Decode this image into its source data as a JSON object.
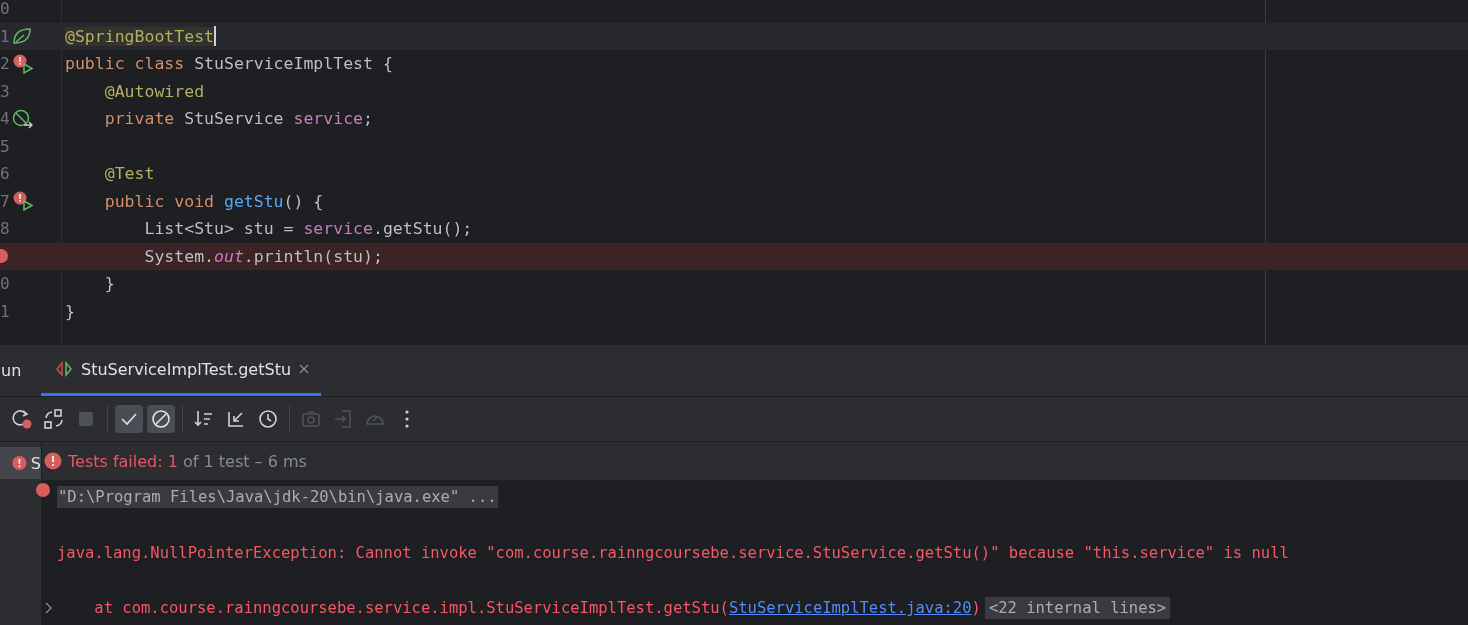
{
  "editor": {
    "lines": [
      {
        "number": "0",
        "current": false,
        "breakpoint": false
      },
      {
        "number": "1",
        "marker": {
          "kind": "leaf"
        },
        "current": true,
        "breakpoint": false,
        "tokens": [
          {
            "text": "@SpringBootTest",
            "kind": "annotation"
          }
        ]
      },
      {
        "number": "2",
        "marker": {
          "kind": "run-failed"
        },
        "current": false,
        "breakpoint": false,
        "tokens": [
          {
            "text": "public class ",
            "kind": "keyword"
          },
          {
            "text": "StuServiceImplTest {",
            "kind": "plain"
          }
        ]
      },
      {
        "number": "3",
        "current": false,
        "breakpoint": false,
        "tokens": [
          {
            "text": "    @Autowired",
            "kind": "annotation"
          }
        ]
      },
      {
        "number": "4",
        "marker": {
          "kind": "bean"
        },
        "current": false,
        "breakpoint": false,
        "tokens": [
          {
            "text": "    private ",
            "kind": "keyword"
          },
          {
            "text": "StuService ",
            "kind": "plain"
          },
          {
            "text": "service",
            "kind": "field"
          },
          {
            "text": ";",
            "kind": "plain"
          }
        ]
      },
      {
        "number": "5",
        "current": false,
        "breakpoint": false
      },
      {
        "number": "6",
        "current": false,
        "breakpoint": false,
        "tokens": [
          {
            "text": "    @Test",
            "kind": "annotation"
          }
        ]
      },
      {
        "number": "7",
        "marker": {
          "kind": "run-failed"
        },
        "current": false,
        "breakpoint": false,
        "tokens": [
          {
            "text": "    public void ",
            "kind": "keyword"
          },
          {
            "text": "getStu",
            "kind": "method"
          },
          {
            "text": "() {",
            "kind": "plain"
          }
        ]
      },
      {
        "number": "8",
        "current": false,
        "breakpoint": false,
        "tokens": [
          {
            "text": "        List<Stu> stu = ",
            "kind": "plain"
          },
          {
            "text": "service",
            "kind": "field"
          },
          {
            "text": ".getStu();",
            "kind": "plain"
          }
        ]
      },
      {
        "current": false,
        "breakpoint": true,
        "tokens": [
          {
            "text": "        System.",
            "kind": "plain"
          },
          {
            "text": "out",
            "kind": "static"
          },
          {
            "text": ".println(stu);",
            "kind": "plain"
          }
        ]
      },
      {
        "number": "0",
        "current": false,
        "breakpoint": false,
        "tokens": [
          {
            "text": "    }",
            "kind": "plain"
          }
        ]
      },
      {
        "number": "1",
        "current": false,
        "breakpoint": false,
        "tokens": [
          {
            "text": "}",
            "kind": "plain"
          }
        ]
      }
    ]
  },
  "run_panel": {
    "title": "un",
    "tabs": [
      {
        "label": "StuServiceImplTest.getStu",
        "selected": true
      }
    ],
    "toolbar": [
      {
        "kind": "rerun-failed",
        "selected": false,
        "disabled": false
      },
      {
        "kind": "rerun-toggle",
        "selected": false,
        "disabled": false
      },
      {
        "kind": "stop",
        "selected": false,
        "disabled": true
      },
      {
        "kind": "sep"
      },
      {
        "kind": "check",
        "selected": true,
        "disabled": false
      },
      {
        "kind": "ban",
        "selected": true,
        "disabled": false
      },
      {
        "kind": "sep"
      },
      {
        "kind": "sort",
        "selected": false,
        "disabled": false
      },
      {
        "kind": "collapse",
        "selected": false,
        "disabled": false
      },
      {
        "kind": "clock",
        "selected": false,
        "disabled": false
      },
      {
        "kind": "sep"
      },
      {
        "kind": "camera",
        "selected": false,
        "disabled": true
      },
      {
        "kind": "export",
        "selected": false,
        "disabled": true
      },
      {
        "kind": "gauge",
        "selected": false,
        "disabled": true
      },
      {
        "kind": "more",
        "selected": false,
        "disabled": false
      }
    ],
    "tree": [
      {
        "label": "S",
        "selected": true
      }
    ],
    "status": {
      "failed": "Tests failed: 1",
      "rest": " of 1 test – 6 ms"
    },
    "console": [
      {
        "kind": "command",
        "text": "\"D:\\Program Files\\Java\\jdk-20\\bin\\java.exe\" ..."
      },
      {
        "kind": "error",
        "text": "java.lang.NullPointerException: Cannot invoke \"com.course.rainngcoursebe.service.StuService.getStu()\" because \"this.service\" is null"
      },
      {
        "kind": "stack",
        "text": "    at com.course.rainngcoursebe.service.impl.StuServiceImplTest.getStu(",
        "link": "StuServiceImplTest.java:20",
        "after": ")",
        "folded": "<22 internal lines>"
      }
    ]
  }
}
